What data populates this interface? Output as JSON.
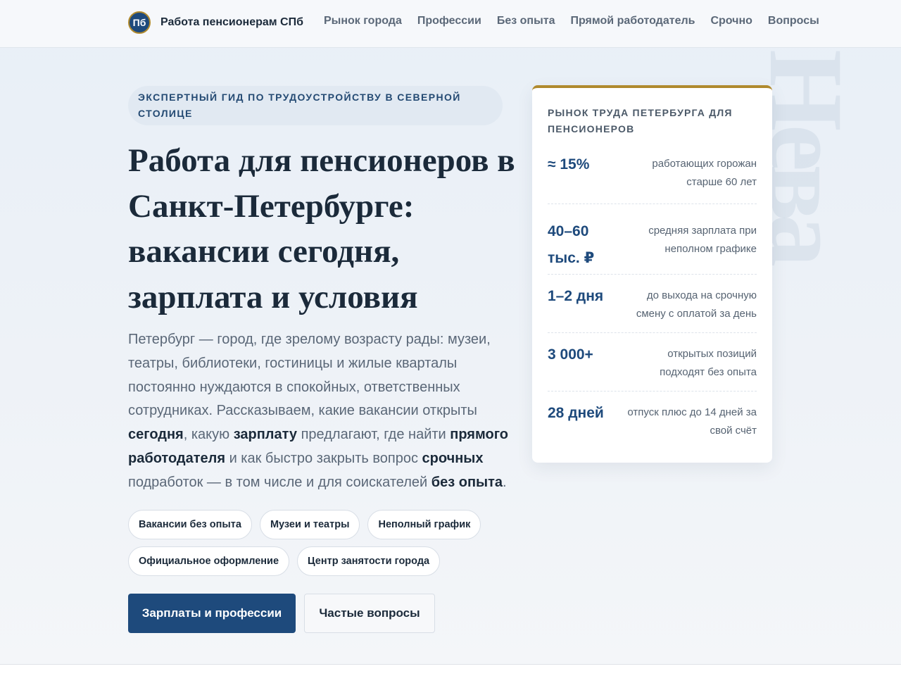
{
  "header": {
    "logo": "Пб",
    "site_name": "Работа пенсионерам СПб",
    "nav": [
      "Рынок города",
      "Профессии",
      "Без опыта",
      "Прямой работодатель",
      "Срочно",
      "Вопросы"
    ]
  },
  "watermark": "Нева",
  "hero": {
    "eyebrow": "ЭКСПЕРТНЫЙ ГИД ПО ТРУДОУСТРОЙСТВУ В СЕВЕРНОЙ СТОЛИЦЕ",
    "title": "Работа для пенсионеров в Санкт-Петербурге: вакансии сегодня, зарплата и условия",
    "intro": [
      {
        "text": "Петербург — город, где зрелому возрасту рады: музеи, театры, библиотеки, гостиницы и жилые кварталы постоянно нуждаются в спокойных, ответственных сотрудниках. Рассказываем, какие вакансии открыты ",
        "bold": false
      },
      {
        "text": "сегодня",
        "bold": true
      },
      {
        "text": ", какую ",
        "bold": false
      },
      {
        "text": "зарплату",
        "bold": true
      },
      {
        "text": " предлагают, где найти ",
        "bold": false
      },
      {
        "text": "прямого работодателя",
        "bold": true
      },
      {
        "text": " и как быстро закрыть вопрос ",
        "bold": false
      },
      {
        "text": "срочных",
        "bold": true
      },
      {
        "text": " подработок — в том числе и для соискателей ",
        "bold": false
      },
      {
        "text": "без опыта",
        "bold": true
      },
      {
        "text": ".",
        "bold": false
      }
    ],
    "chips": [
      "Вакансии без опыта",
      "Музеи и театры",
      "Неполный график",
      "Официальное оформление",
      "Центр занятости города"
    ],
    "primary_button": "Зарплаты и профессии",
    "secondary_button": "Частые вопросы"
  },
  "stats_card": {
    "title": "РЫНОК ТРУДА ПЕТЕРБУРГА ДЛЯ ПЕНСИОНЕРОВ",
    "items": [
      {
        "value": "≈ 15%",
        "label": "работающих горожан старше 60 лет"
      },
      {
        "value": "40–60 тыс. ₽",
        "label": "средняя зарплата при неполном графике"
      },
      {
        "value": "1–2 дня",
        "label": "до выхода на срочную смену с оплатой за день"
      },
      {
        "value": "3 000+",
        "label": "открытых позиций подходят без опыта"
      },
      {
        "value": "28 дней",
        "label": "отпуск плюс до 14 дней за свой счёт"
      }
    ]
  },
  "colors": {
    "primary": "#1e4a7c",
    "accent": "#b08a2e",
    "text": "#1b2a3a",
    "muted": "#5a6777"
  }
}
